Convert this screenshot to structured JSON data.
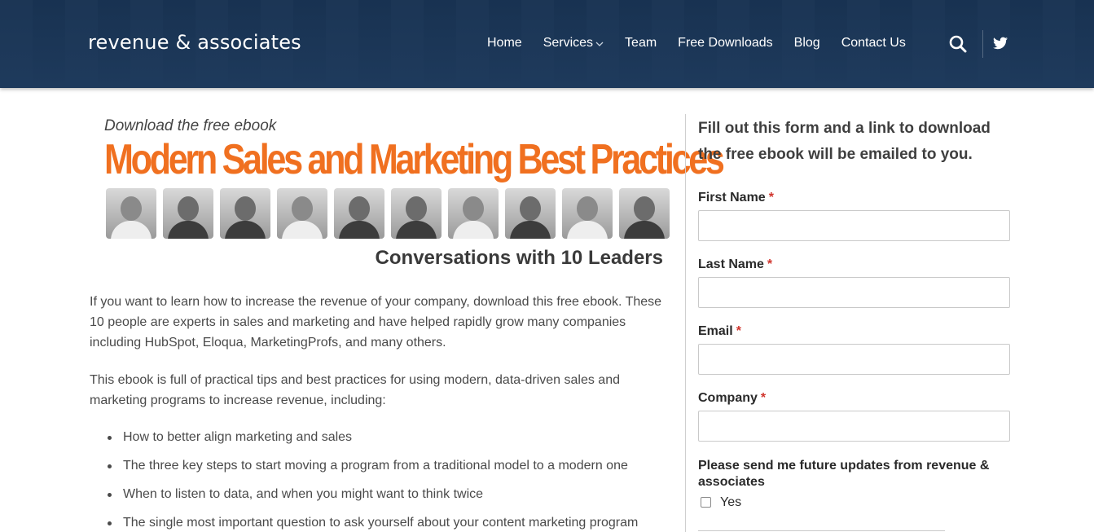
{
  "header": {
    "logo_text": "revenue & associates",
    "nav": [
      "Home",
      "Services",
      "Team",
      "Free Downloads",
      "Blog",
      "Contact Us"
    ],
    "icons": [
      "search-icon",
      "twitter-icon",
      "chevron-down-icon"
    ],
    "background_color": "#1e3a5c"
  },
  "banner": {
    "kicker": "Download the free ebook",
    "title": "Modern Sales and Marketing Best Practices",
    "subtitle": "Conversations with 10 Leaders",
    "title_color": "#f07020"
  },
  "content": {
    "paragraph1": "If you want to learn how to increase the revenue of your company, download this free ebook. These 10 people are experts in sales and marketing and have helped rapidly grow many companies including HubSpot, Eloqua, MarketingProfs, and many others.",
    "paragraph2": "This ebook is full of practical tips and best practices for using modern, data-driven sales and marketing programs to increase revenue, including:",
    "bullets": [
      "How to better align marketing and sales",
      "The three key steps to start moving a program from a traditional model to a modern one",
      "When to listen to data, and when you might want to think twice",
      "The single most important question to ask yourself about your content marketing program"
    ]
  },
  "form": {
    "heading": "Fill out this form and a link to download the free ebook will be emailed to you.",
    "fields": [
      {
        "label": "First Name",
        "required": "*",
        "value": ""
      },
      {
        "label": "Last Name",
        "required": "*",
        "value": ""
      },
      {
        "label": "Email",
        "required": "*",
        "value": ""
      },
      {
        "label": "Company",
        "required": "*",
        "value": ""
      }
    ],
    "updates_label": "Please send me future updates from revenue & associates",
    "checkbox_label": "Yes",
    "required_color": "#d0342c"
  }
}
